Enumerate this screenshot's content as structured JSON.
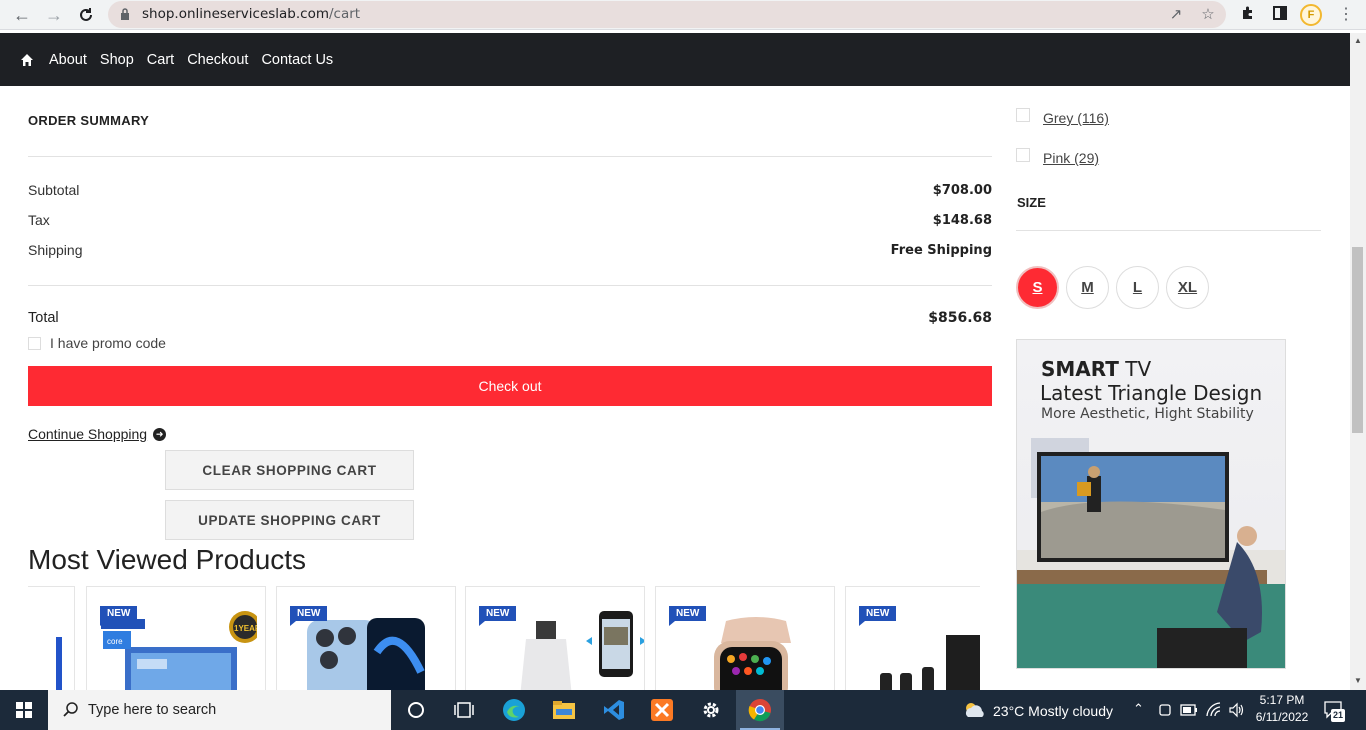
{
  "browser": {
    "url_domain": "shop.onlineserviceslab.com",
    "url_path": "/cart",
    "profile_initial": "F"
  },
  "site_nav": {
    "items": [
      "About",
      "Shop",
      "Cart",
      "Checkout",
      "Contact Us"
    ]
  },
  "order_summary": {
    "title": "ORDER SUMMARY",
    "subtotal_label": "Subtotal",
    "subtotal_value": "$708.00",
    "tax_label": "Tax",
    "tax_value": "$148.68",
    "shipping_label": "Shipping",
    "shipping_value": "Free Shipping",
    "total_label": "Total",
    "total_value": "$856.68",
    "promo_label": "I have promo code",
    "checkout_label": "Check out",
    "continue_label": "Continue Shopping",
    "clear_label": "CLEAR SHOPPING CART",
    "update_label": "UPDATE SHOPPING CART"
  },
  "most_viewed": {
    "title": "Most Viewed Products",
    "badge": "NEW",
    "products": [
      {
        "badge": "NEW",
        "icon": "laptop-product-image"
      },
      {
        "badge": "NEW",
        "icon": "iphone-product-image"
      },
      {
        "badge": "NEW",
        "icon": "bulb-camera-product-image"
      },
      {
        "badge": "NEW",
        "icon": "smartwatch-product-image"
      },
      {
        "badge": "NEW",
        "icon": "speaker-product-image"
      }
    ],
    "laptop_overlay": "1YEAR"
  },
  "sidebar": {
    "colors": [
      {
        "label": "Grey (116)"
      },
      {
        "label": "Pink (29)"
      }
    ],
    "size_title": "SIZE",
    "sizes": [
      "S",
      "M",
      "L",
      "XL"
    ],
    "selected_size": "S",
    "banner": {
      "line1_bold": "SMART",
      "line1_rest": " TV",
      "line2": "Latest Triangle Design",
      "line3": "More Aesthetic, Hight Stability"
    }
  },
  "taskbar": {
    "search_placeholder": "Type here to search",
    "weather": "23°C  Mostly cloudy",
    "time": "5:17 PM",
    "date": "6/11/2022",
    "notification_count": "21"
  },
  "colors": {
    "accent_red": "#fe2a33",
    "nav_bg": "#1e2024",
    "badge_blue": "#2151b8"
  }
}
